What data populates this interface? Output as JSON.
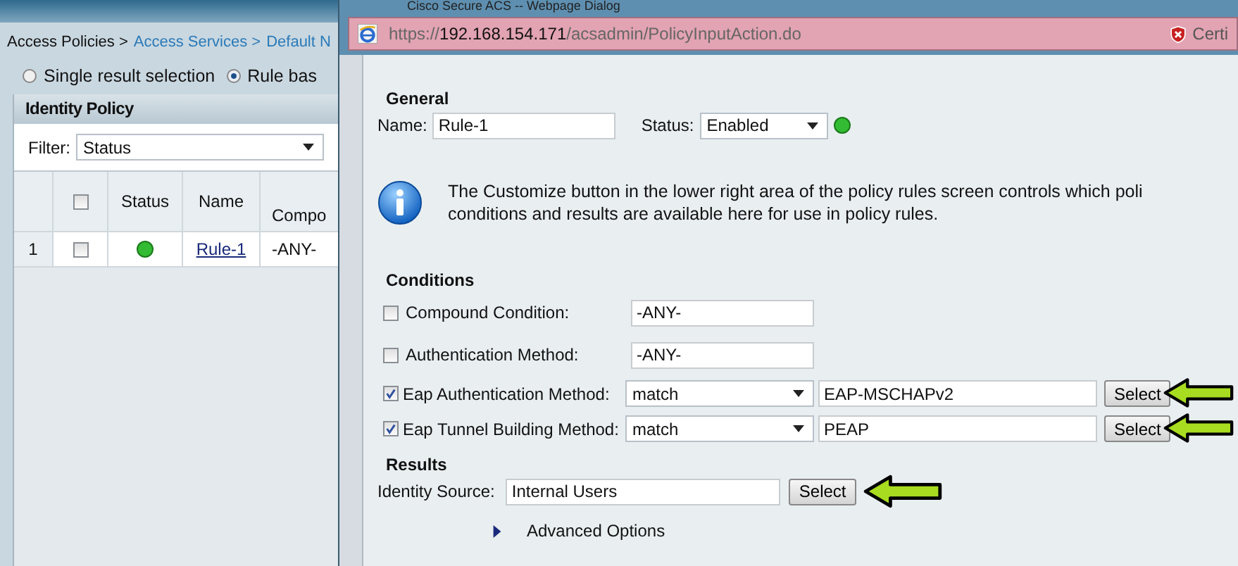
{
  "breadcrumb": [
    {
      "label": "Access Policies >",
      "link": false
    },
    {
      "label": "Access Services >",
      "link": true
    },
    {
      "label": "Default N",
      "link": true
    }
  ],
  "result_mode": [
    {
      "label": "Single result selection",
      "selected": false
    },
    {
      "label": "Rule bas",
      "selected": true
    }
  ],
  "identity_policy": {
    "title": "Identity Policy",
    "filter_label": "Filter:",
    "filter_value": "Status",
    "columns": [
      "Status",
      "Name",
      "Compo"
    ],
    "select_all_checked": false,
    "rows": [
      {
        "number": "1",
        "checked": false,
        "color": "#33bb33",
        "name": "Rule-1",
        "column_4": "-ANY-"
      }
    ]
  },
  "dialog": {
    "title": "Cisco Secure ACS -- Webpage Dialog",
    "url_scheme": "https://",
    "url_host": "192.168.154.171",
    "url_path": "/acsadmin/PolicyInputAction.do",
    "certificate": "Certi",
    "general": {
      "heading": "General",
      "name_label": "Name:",
      "name_value": "Rule-1",
      "status_label": "Status:",
      "status_value": "Enabled",
      "color": "#33bb33"
    },
    "info": [
      "The Customize button in the lower right area of the policy rules screen controls which poli",
      "conditions and results are available here for use in policy rules."
    ],
    "conditions_heading": "Conditions",
    "conditions": [
      {
        "kind": "text",
        "label": "Compound Condition:",
        "checked": false,
        "value": "-ANY-"
      },
      {
        "kind": "text",
        "label": "Authentication Method:",
        "checked": false,
        "value": "-ANY-"
      },
      {
        "kind": "match",
        "label": "Eap Authentication Method:",
        "checked": true,
        "operator": "match",
        "value": "EAP-MSCHAPv2",
        "button": "Select",
        "arrow": true
      },
      {
        "kind": "match",
        "label": "Eap Tunnel Building Method:",
        "checked": true,
        "operator": "match",
        "value": "PEAP",
        "button": "Select",
        "arrow": true
      }
    ],
    "results_heading": "Results",
    "identity_source_label": "Identity Source:",
    "identity_source_value": "Internal Users",
    "identity_button": "Select",
    "identity_arrow": true,
    "advanced": "Advanced Options"
  }
}
